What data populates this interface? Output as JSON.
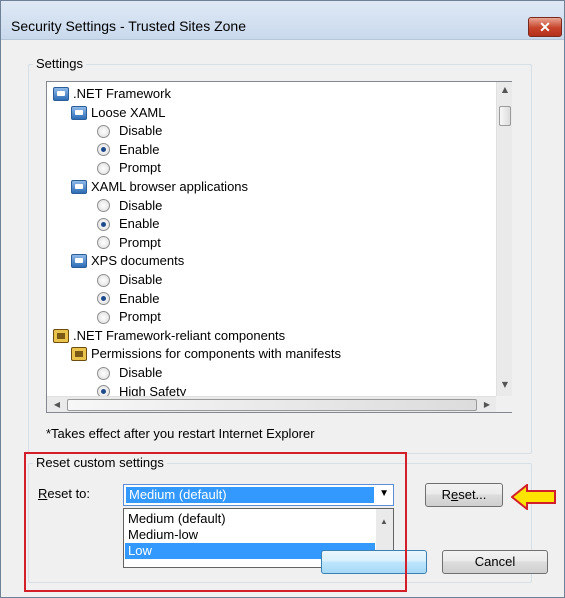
{
  "window": {
    "title": "Security Settings - Trusted Sites Zone",
    "close_glyph": "✕"
  },
  "settings_group": {
    "label": "Settings"
  },
  "tree": {
    "rows": [
      {
        "kind": "category",
        "icon": "net-settings-icon",
        "label": ".NET Framework"
      },
      {
        "kind": "setting",
        "icon": "net-settings-icon",
        "label": "Loose XAML"
      },
      {
        "kind": "option",
        "label": "Disable",
        "checked": false
      },
      {
        "kind": "option",
        "label": "Enable",
        "checked": true
      },
      {
        "kind": "option",
        "label": "Prompt",
        "checked": false
      },
      {
        "kind": "setting",
        "icon": "net-settings-icon",
        "label": "XAML browser applications"
      },
      {
        "kind": "option",
        "label": "Disable",
        "checked": false
      },
      {
        "kind": "option",
        "label": "Enable",
        "checked": true
      },
      {
        "kind": "option",
        "label": "Prompt",
        "checked": false
      },
      {
        "kind": "setting",
        "icon": "net-settings-icon",
        "label": "XPS documents"
      },
      {
        "kind": "option",
        "label": "Disable",
        "checked": false
      },
      {
        "kind": "option",
        "label": "Enable",
        "checked": true
      },
      {
        "kind": "option",
        "label": "Prompt",
        "checked": false
      },
      {
        "kind": "category",
        "icon": "component-lock-icon",
        "label": ".NET Framework-reliant components"
      },
      {
        "kind": "setting",
        "icon": "component-lock-icon",
        "label": "Permissions for components with manifests"
      },
      {
        "kind": "option",
        "label": "Disable",
        "checked": false
      },
      {
        "kind": "option",
        "label": "High Safety",
        "checked": true
      }
    ]
  },
  "note": "*Takes effect after you restart Internet Explorer",
  "reset_group": {
    "label": "Reset custom settings"
  },
  "reset": {
    "label_prefix": "R",
    "label_rest": "eset to:",
    "selected": "Medium (default)",
    "options": [
      "Medium (default)",
      "Medium-low",
      "Low"
    ],
    "highlighted_option": "Low",
    "button_prefix": "R",
    "button_underlined": "e",
    "button_rest": "set..."
  },
  "buttons": {
    "ok": "",
    "cancel": "Cancel"
  },
  "colors": {
    "annotation_red": "#d21f2a",
    "annotation_arrow_fill": "#ffe400",
    "selection_blue": "#3399ff"
  }
}
